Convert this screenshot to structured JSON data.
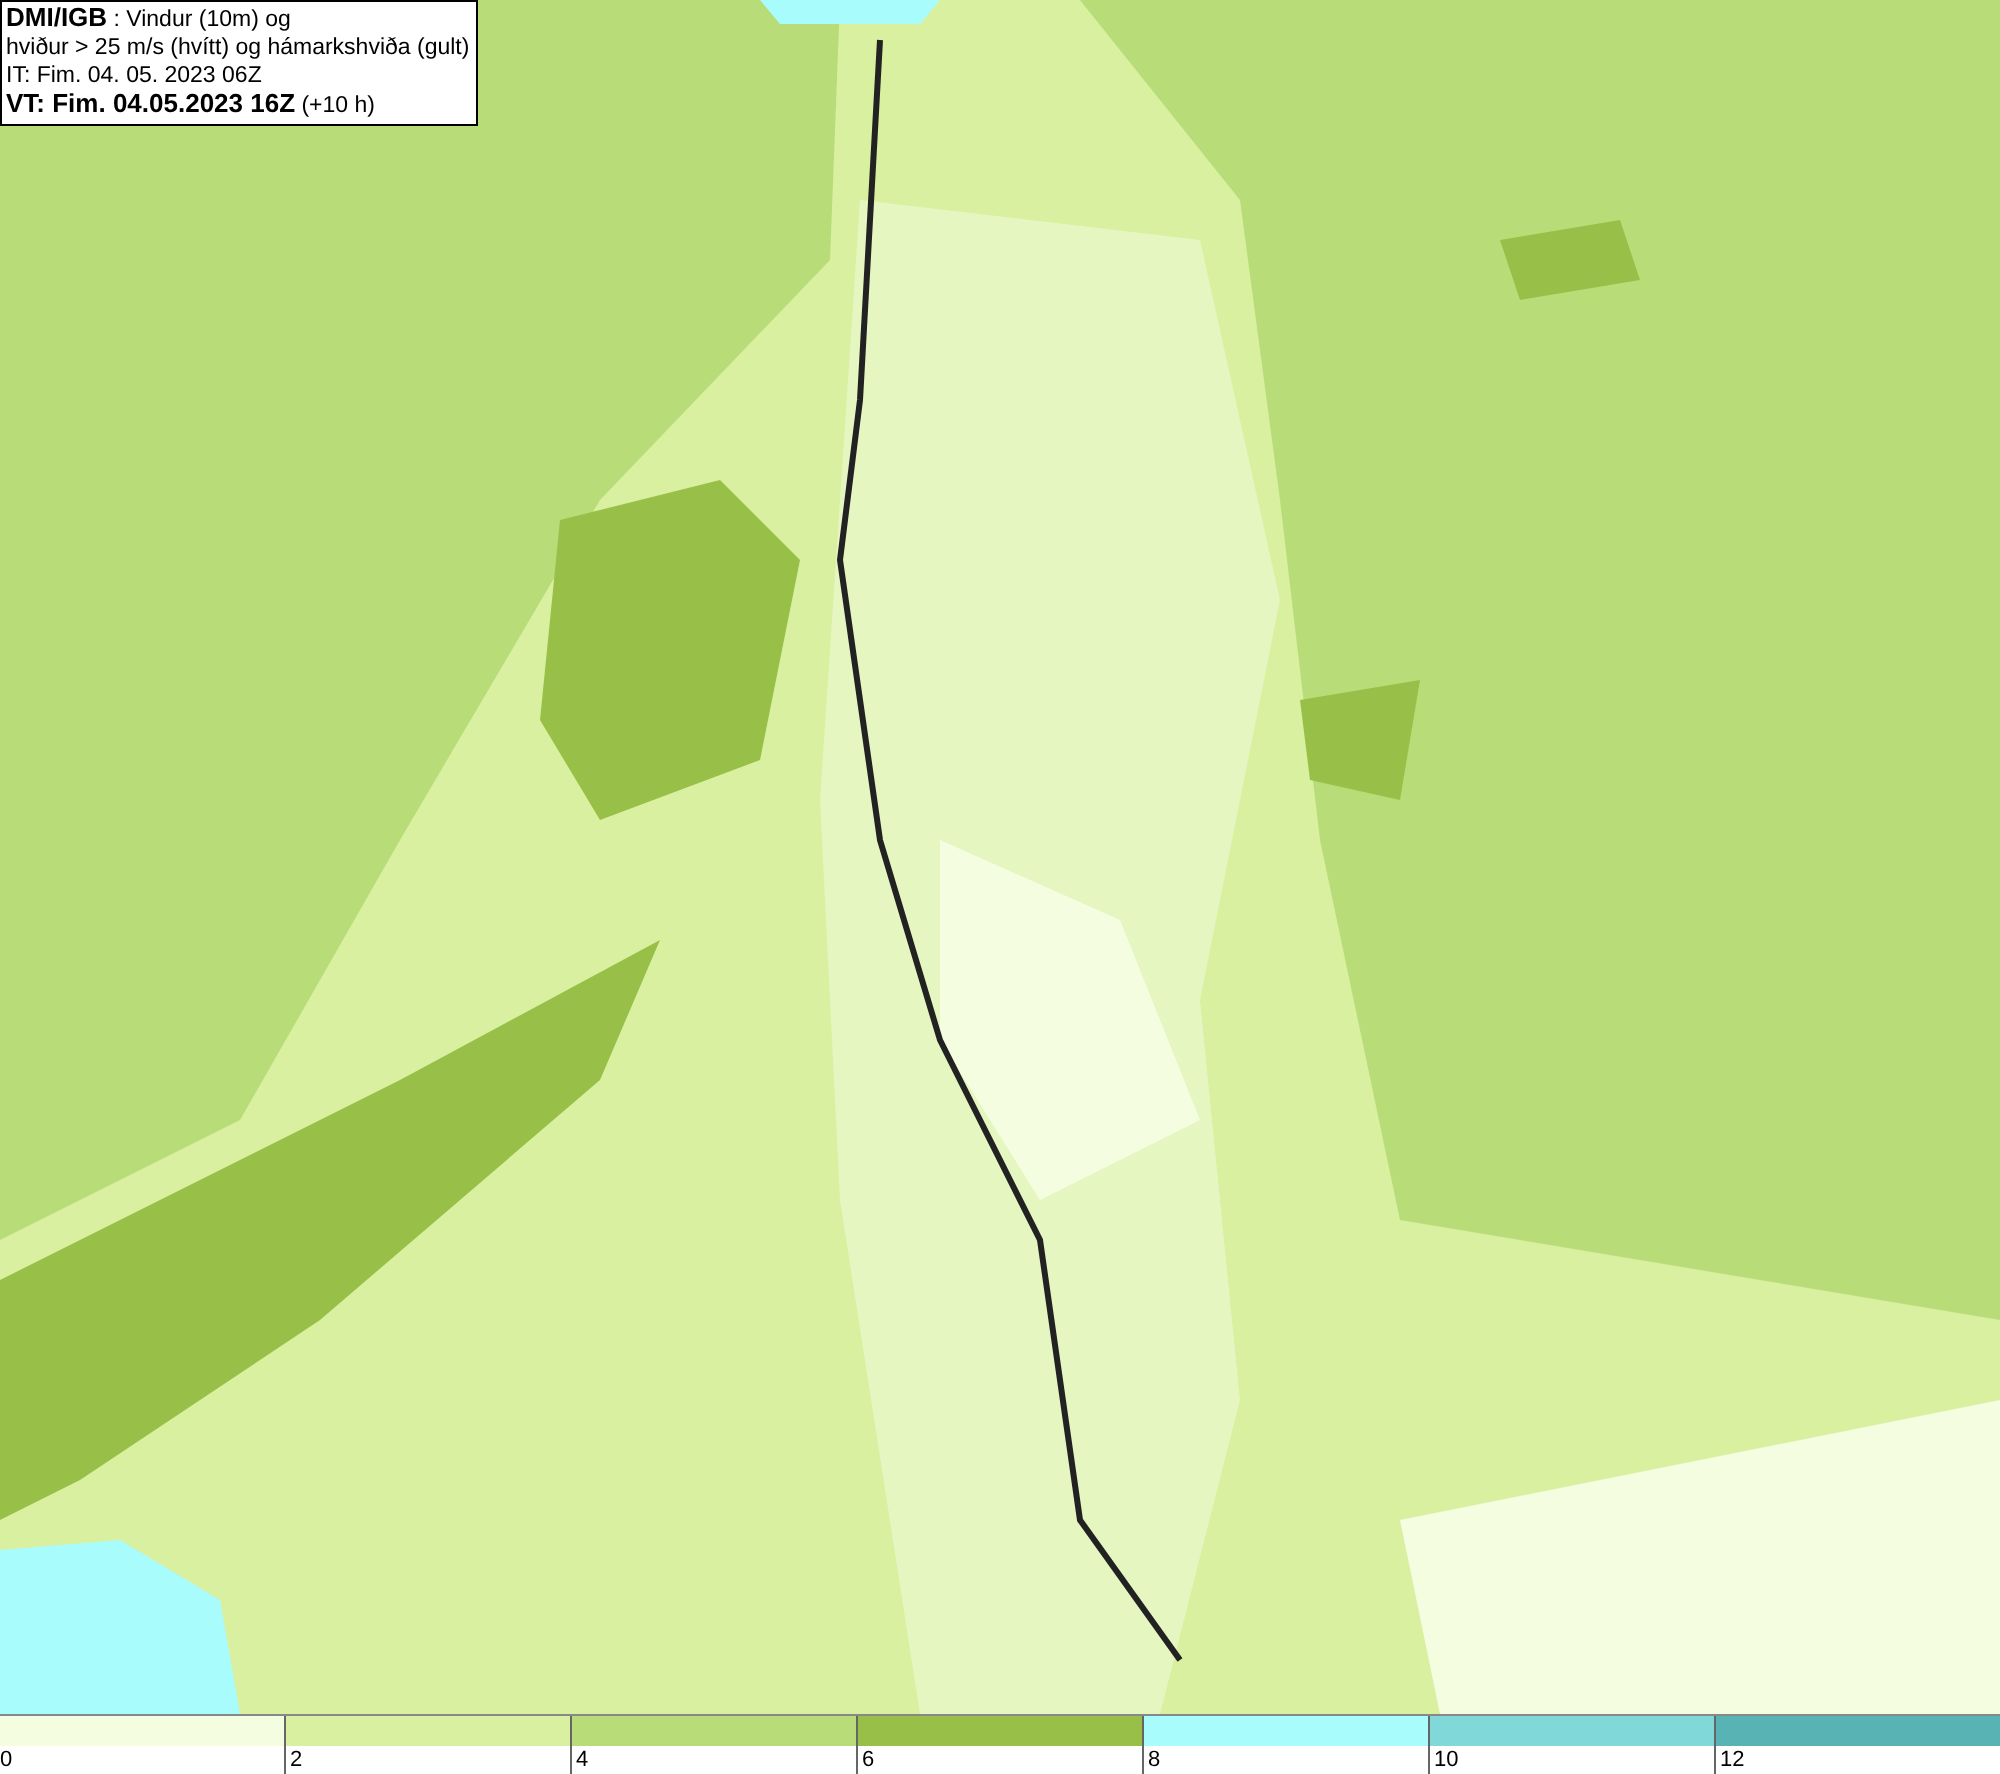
{
  "header": {
    "lines": [
      "**DMI/IGB** : Vindur (10m) og",
      "hviður > 25 m/s (hvítt) og hámarkshviða (gult)",
      "IT: Fim. 04. 05. 2023 06Z",
      "**VT: Fim. 04.05.2023 16Z** (+10 h)"
    ]
  },
  "legend": {
    "bins": [
      {
        "color": "#f5fde0",
        "label": "0"
      },
      {
        "color": "#d8f0a0",
        "label": "2"
      },
      {
        "color": "#b8dc78",
        "label": "4"
      },
      {
        "color": "#98c048",
        "label": "6"
      },
      {
        "color": "#a8fcfc",
        "label": "8"
      },
      {
        "color": "#80d8d8",
        "label": "10"
      },
      {
        "color": "#58b4b4",
        "label": "12"
      }
    ]
  }
}
